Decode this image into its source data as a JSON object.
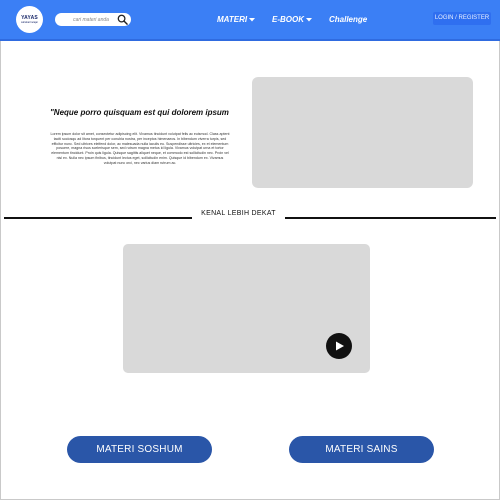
{
  "header": {
    "logo": {
      "word": "YAYAS",
      "sub": "sahabat belajar"
    },
    "search": {
      "placeholder": "cari materi anda"
    },
    "nav": [
      {
        "label": "MATERI",
        "has_dropdown": true
      },
      {
        "label": "E-BOOK",
        "has_dropdown": true
      },
      {
        "label": "Challenge",
        "has_dropdown": false
      }
    ],
    "login_label": "LOGIN / REGISTER"
  },
  "hero": {
    "quote": "\"Neque porro quisquam est qui dolorem ipsum",
    "body": "Lorem ipsum dolor sit amet, consectetur adipiscing elit. Vivamus tincidunt volutpat felis ac euismod. Class aptent taciti sociosqu ad litora torquent per conubia nostra, per inceptos himenaeos. In bibendum viverra turpis, sed efficitur nunc. Sed ultrices eleifend dolor, ac malesuada nulla iaculis eu. Suspendisse ultricies, ex et elementum posuere, magna risus scelerisque sem, sed rutrum magna metus id ligula. Vivamus volutpat urna et tortor elementum tincidunt. Proin quis ligula. Quisque sagittis aliquet neque, et commodo est sollicitudin nec. Proin vel nisl ex. Nulla nec ipsum finibus, tincidunt lectus eget, sollicitudin enim. Quisque id bibendum ex. Vivamus volutpat nunc orci, nec varius diam rutrum ac."
  },
  "section": {
    "title": "KENAL LEBIH DEKAT"
  },
  "buttons": {
    "soshum": "MATERI SOSHUM",
    "sains": "MATERI SAINS"
  },
  "colors": {
    "header_bg": "#3b7ff5",
    "button_bg": "#2a56a8",
    "placeholder_gray": "#d9d9d9"
  },
  "icons": [
    "search-icon",
    "chevron-down-icon",
    "play-icon"
  ]
}
